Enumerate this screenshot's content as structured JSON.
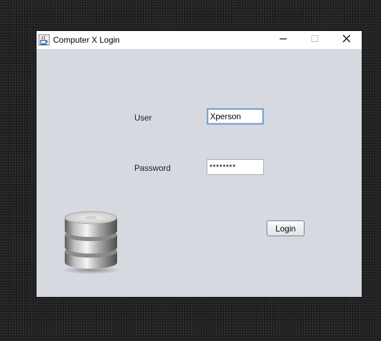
{
  "window": {
    "title": "Computer X Login",
    "app_icon": "java-cup-icon",
    "controls": {
      "minimize_icon": "minimize-icon",
      "maximize_icon": "maximize-icon",
      "close_icon": "close-icon"
    }
  },
  "form": {
    "user_label": "User",
    "user_value": "Xperson",
    "password_label": "Password",
    "password_value": "********",
    "login_label": "Login"
  },
  "decor": {
    "database_icon": "database-icon"
  },
  "colors": {
    "desktop": "#1f1f21",
    "window_bg": "#d6d9e0",
    "titlebar_bg": "#ffffff",
    "focus_border": "#7da2ce"
  }
}
